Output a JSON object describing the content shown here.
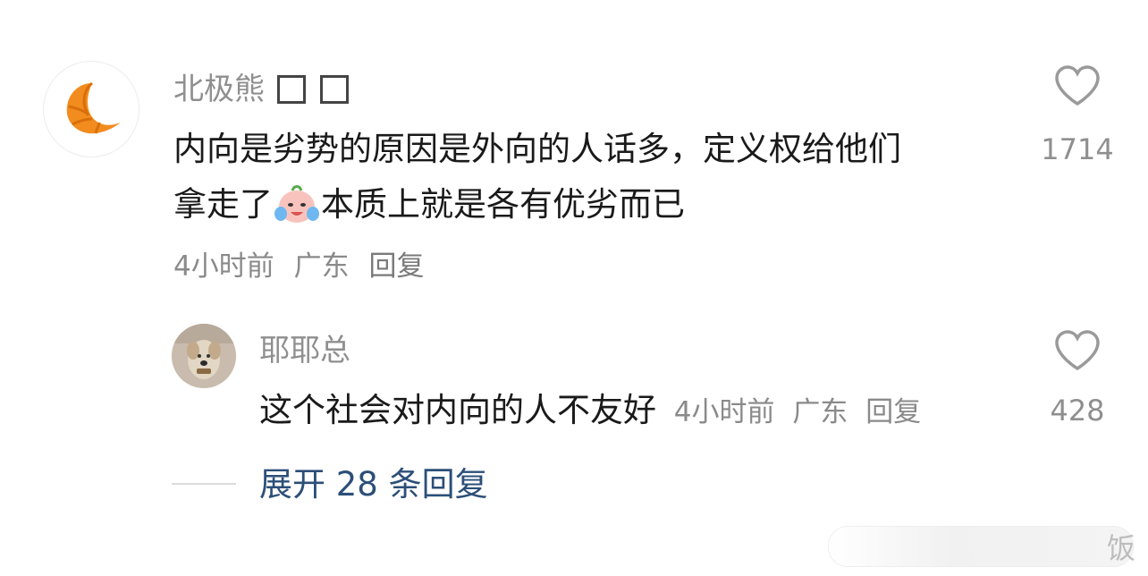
{
  "comment": {
    "username": "北极熊",
    "text_line1": "内向是劣势的原因是外向的人话多，定义权给他们",
    "text_line2_before_emoji": "拿走了",
    "text_line2_after_emoji": "本质上就是各有优劣而已",
    "time": "4小时前",
    "location": "广东",
    "reply_label": "回复",
    "like_count": "1714"
  },
  "reply": {
    "username": "耶耶总",
    "text": "这个社会对内向的人不友好",
    "time": "4小时前",
    "location": "广东",
    "reply_label": "回复",
    "like_count": "428"
  },
  "expand_label": "展开 28 条回复",
  "watermark_text": "饭",
  "colors": {
    "link": "#2c4f78",
    "meta": "#8a8a8a",
    "text": "#1a1a1a",
    "croissant": "#f28c1e"
  }
}
